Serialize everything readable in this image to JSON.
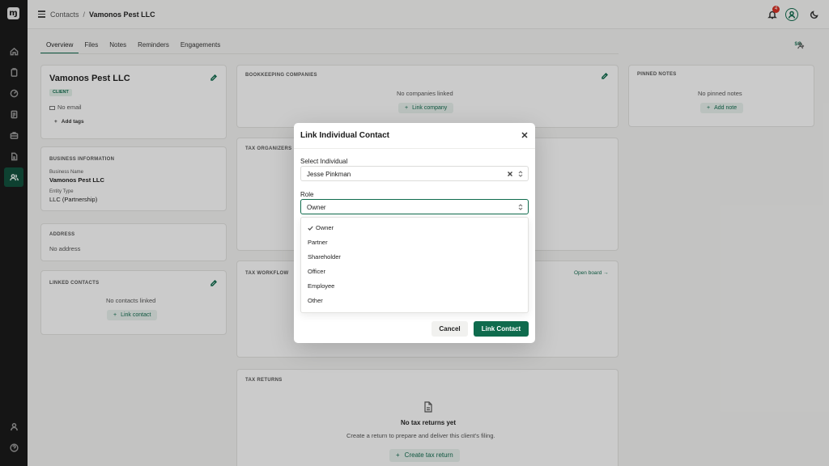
{
  "topbar": {
    "breadcrumb_root": "Contacts",
    "breadcrumb_separator": "/",
    "breadcrumb_current": "Vamonos Pest LLC",
    "notification_count": "4"
  },
  "tabs": [
    {
      "label": "Overview"
    },
    {
      "label": "Files"
    },
    {
      "label": "Notes"
    },
    {
      "label": "Reminders"
    },
    {
      "label": "Engagements"
    }
  ],
  "top_right_label": "SG",
  "client": {
    "name": "Vamonos Pest LLC",
    "tag": "CLIENT",
    "email": "No email",
    "add_tags": "Add tags"
  },
  "business_info": {
    "title": "BUSINESS INFORMATION",
    "name_label": "Business Name",
    "name_value": "Vamonos Pest LLC",
    "entity_label": "Entity Type",
    "entity_value": "LLC (Partnership)"
  },
  "address": {
    "title": "ADDRESS",
    "value": "No address"
  },
  "linked_contacts": {
    "title": "LINKED CONTACTS",
    "empty": "No contacts linked",
    "button": "Link contact"
  },
  "bookkeeping": {
    "title": "BOOKKEEPING COMPANIES",
    "empty": "No companies linked",
    "button": "Link company"
  },
  "pinned_notes": {
    "title": "PINNED NOTES",
    "empty": "No pinned notes",
    "button": "Add note"
  },
  "tax_organizers": {
    "title": "TAX ORGANIZERS"
  },
  "tax_workflow": {
    "title": "TAX WORKFLOW",
    "link": "Open board →"
  },
  "tax_returns": {
    "title": "TAX RETURNS",
    "empty_title": "No tax returns yet",
    "empty_desc": "Create a return to prepare and deliver this client's filing.",
    "button": "Create tax return"
  },
  "modal": {
    "title": "Link Individual Contact",
    "individual_label": "Select Individual",
    "individual_value": "Jesse Pinkman",
    "role_label": "Role",
    "role_value": "Owner",
    "role_options": [
      {
        "label": "Owner",
        "selected": true
      },
      {
        "label": "Partner"
      },
      {
        "label": "Shareholder"
      },
      {
        "label": "Officer"
      },
      {
        "label": "Employee"
      },
      {
        "label": "Other"
      }
    ],
    "cancel_label": "Cancel",
    "submit_label": "Link Contact"
  },
  "colors": {
    "brand": "#0f6b4d",
    "rail": "#161616",
    "badge": "#d92d20"
  }
}
